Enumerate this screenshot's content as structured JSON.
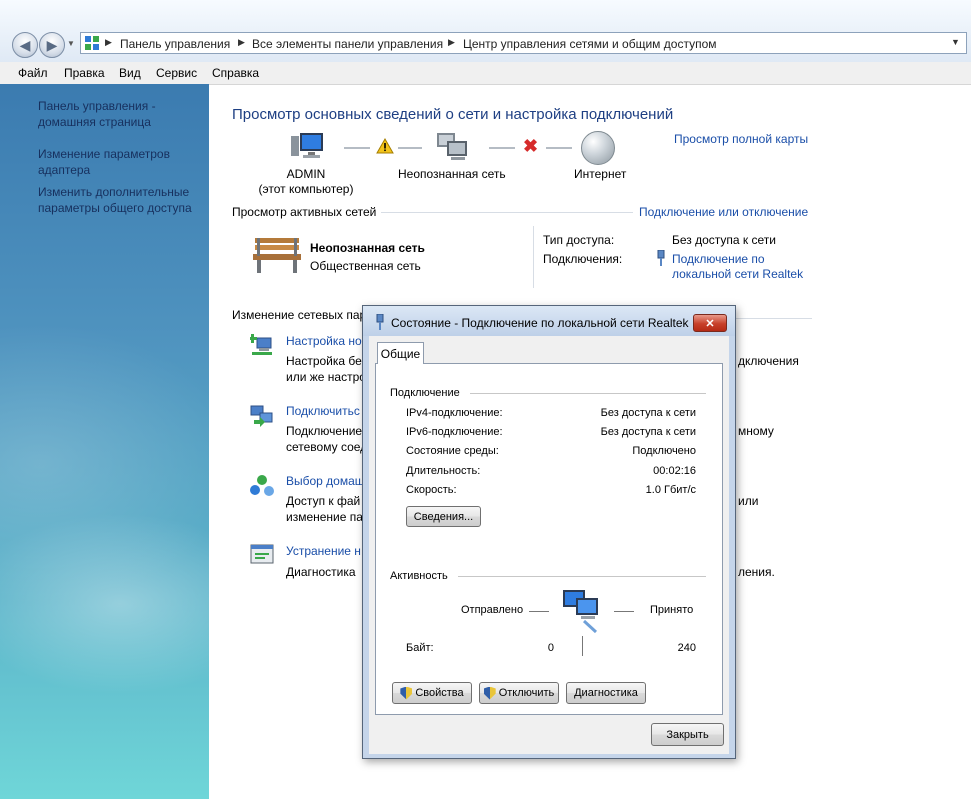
{
  "address": {
    "crumbs": [
      "Панель управления",
      "Все элементы панели управления",
      "Центр управления сетями и общим доступом"
    ]
  },
  "menu": [
    "Файл",
    "Правка",
    "Вид",
    "Сервис",
    "Справка"
  ],
  "sidebar": {
    "items": [
      {
        "label": "Панель управления - домашняя страница"
      },
      {
        "label": "Изменение параметров адаптера"
      },
      {
        "label": "Изменить дополнительные параметры общего доступа"
      }
    ]
  },
  "main": {
    "title": "Просмотр основных сведений о сети и настройка подключений",
    "full_map_link": "Просмотр полной карты",
    "map": {
      "computer_name": "ADMIN",
      "computer_sub": "(этот компьютер)",
      "network": "Неопознанная сеть",
      "internet": "Интернет"
    },
    "active_heading": "Просмотр активных сетей",
    "connect_link": "Подключение или отключение",
    "active_network": {
      "name": "Неопознанная сеть",
      "type": "Общественная сеть",
      "access_label": "Тип доступа:",
      "access_value": "Без доступа к сети",
      "conn_label": "Подключения:",
      "conn_value": "Подключение по локальной сети Realtek"
    },
    "change_heading": "Изменение сетевых пар",
    "tasks": [
      {
        "link": "Настройка но",
        "desc1": "Настройка бе",
        "desc1_tail": "дключения",
        "desc2": "или же настро"
      },
      {
        "link": "Подключитьс",
        "desc1": "Подключение",
        "desc1_tail": "мному",
        "desc2": "сетевому соед"
      },
      {
        "link": "Выбор домаш",
        "desc1": "Доступ к фай",
        "desc1_tail": "или",
        "desc2": "изменение па"
      },
      {
        "link": "Устранение н",
        "desc1": "Диагностика",
        "desc1_tail": "ления.",
        "desc2": ""
      }
    ]
  },
  "dialog": {
    "title": "Состояние - Подключение по локальной сети Realtek",
    "close_glyph": "✕",
    "tab": "Общие",
    "connection_group": "Подключение",
    "rows": [
      {
        "label": "IPv4-подключение:",
        "value": "Без доступа к сети"
      },
      {
        "label": "IPv6-подключение:",
        "value": "Без доступа к сети"
      },
      {
        "label": "Состояние среды:",
        "value": "Подключено"
      },
      {
        "label": "Длительность:",
        "value": "00:02:16"
      },
      {
        "label": "Скорость:",
        "value": "1.0 Гбит/с"
      }
    ],
    "details_button": "Сведения...",
    "activity_group": "Активность",
    "sent_label": "Отправлено",
    "received_label": "Принято",
    "bytes_label": "Байт:",
    "bytes_sent": "0",
    "bytes_received": "240",
    "properties_button": "Свойства",
    "disable_button": "Отключить",
    "diagnose_button": "Диагностика",
    "close_button": "Закрыть"
  },
  "colors": {
    "title_blue": "#1e3f83",
    "link_blue": "#1a4ea8",
    "warning": "#f2c31b",
    "error_red": "#d62b2b"
  }
}
